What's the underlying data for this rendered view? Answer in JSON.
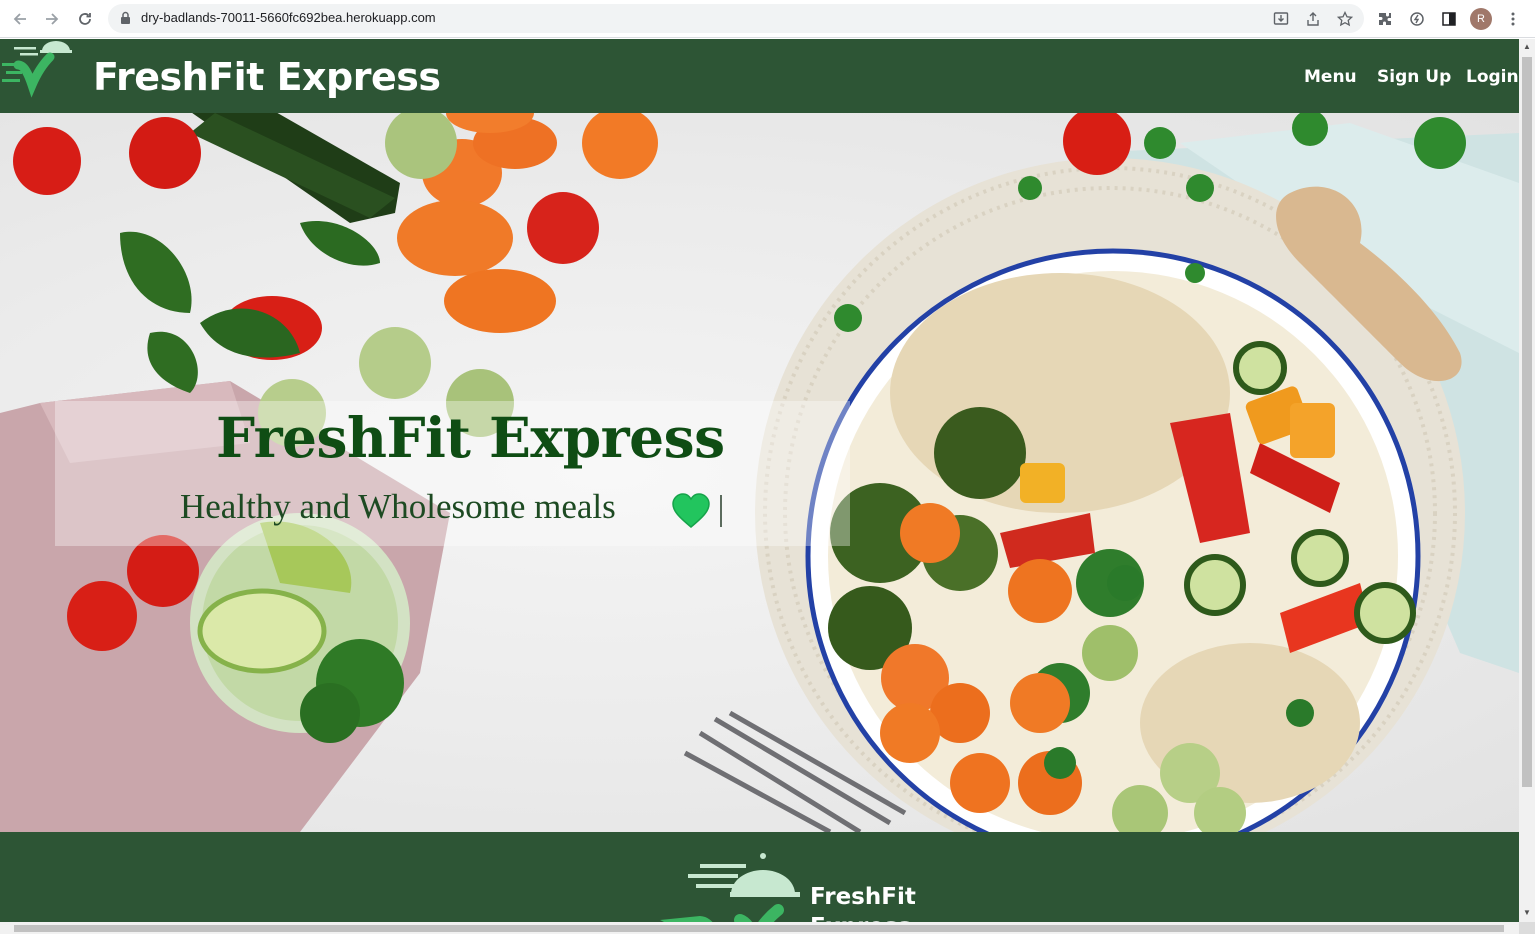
{
  "browser": {
    "url": "dry-badlands-70011-5660fc692bea.herokuapp.com",
    "profile_initial": "R",
    "icons": [
      "back-icon",
      "forward-icon",
      "reload-icon",
      "lock-icon",
      "install-icon",
      "share-icon",
      "star-icon",
      "extensions-icon",
      "sync-icon",
      "side-panel-icon",
      "profile-avatar",
      "more-icon"
    ]
  },
  "navbar": {
    "brand": "FreshFit Express",
    "links": [
      "Menu",
      "Sign Up",
      "Login"
    ]
  },
  "hero": {
    "title": "FreshFit Express",
    "subtitle": "Healthy and Wholesome meals",
    "heart_color": "#22c55e"
  },
  "footer": {
    "brand": "FreshFit Express"
  },
  "colors": {
    "primary": "#2d5535",
    "title_green": "#0f4d14",
    "logo_accent": "#3cb562"
  }
}
